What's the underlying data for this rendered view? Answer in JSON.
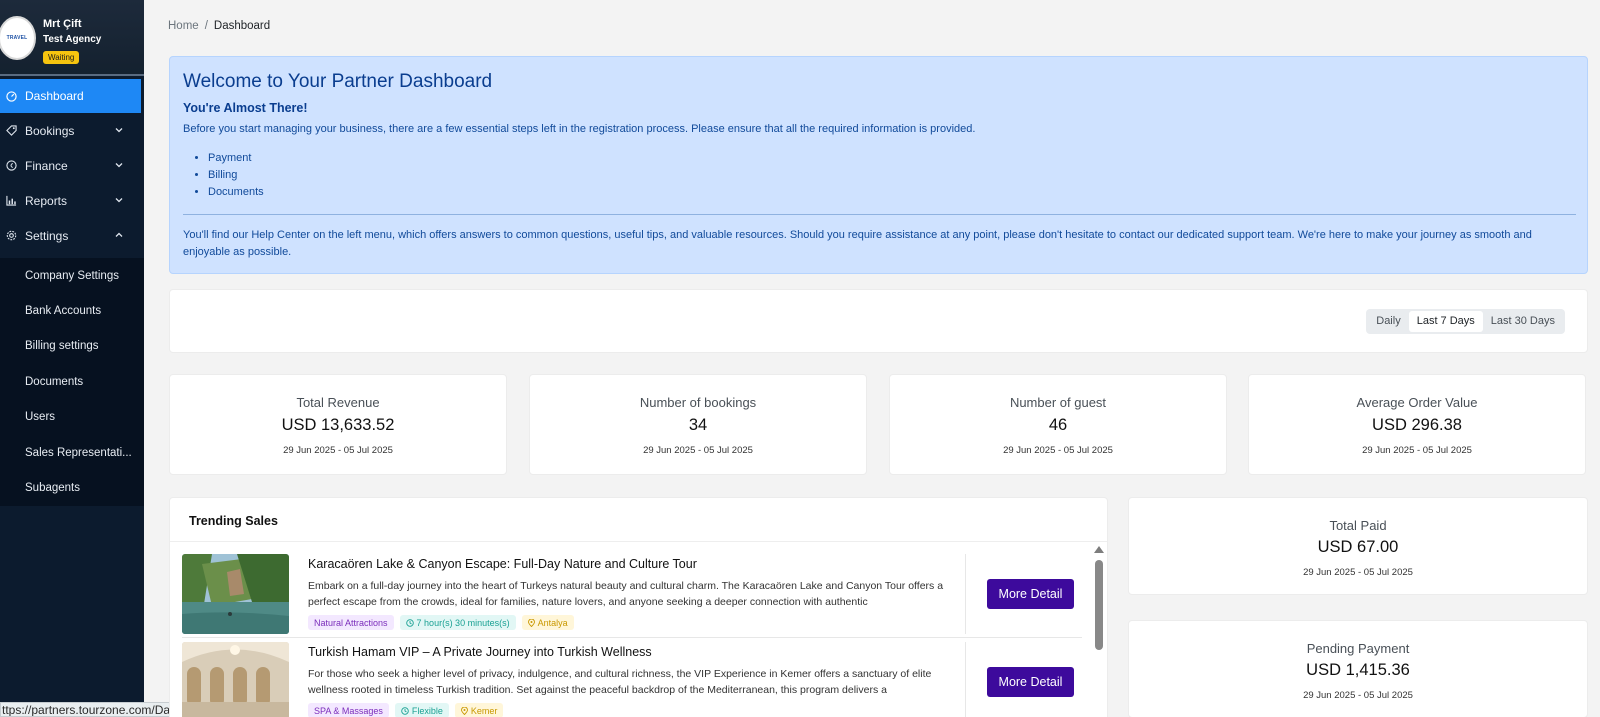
{
  "sidebar": {
    "logo_text": "TRAVEL",
    "user_name": "Mrt Çift",
    "agency_name": "Test Agency",
    "status": "Waiting",
    "nav": [
      {
        "label": "Dashboard",
        "icon": "gauge-icon",
        "active": true
      },
      {
        "label": "Bookings",
        "icon": "tag-icon",
        "chevron": "chevron-down-icon"
      },
      {
        "label": "Finance",
        "icon": "currency-icon",
        "chevron": "chevron-down-icon"
      },
      {
        "label": "Reports",
        "icon": "bar-chart-icon",
        "chevron": "chevron-down-icon"
      },
      {
        "label": "Settings",
        "icon": "gear-icon",
        "chevron": "chevron-up-icon"
      }
    ],
    "settings_submenu": [
      "Company Settings",
      "Bank Accounts",
      "Billing settings",
      "Documents",
      "Users",
      "Sales Representati...",
      "Subagents"
    ]
  },
  "status_bar": {
    "url": "ttps://partners.tourzone.com/Dashboard"
  },
  "breadcrumb": {
    "home": "Home",
    "separator": "/",
    "current": "Dashboard"
  },
  "welcome": {
    "title": "Welcome to Your Partner Dashboard",
    "subtitle": "You're Almost There!",
    "intro": "Before you start managing your business, there are a few essential steps left in the registration process. Please ensure that all the required information is provided.",
    "steps": [
      "Payment",
      "Billing",
      "Documents"
    ],
    "help": "You'll find our Help Center on the left menu, which offers answers to common questions, useful tips, and valuable resources. Should you require assistance at any point, please don't hesitate to contact our dedicated support team. We're here to make your journey as smooth and enjoyable as possible."
  },
  "period": {
    "options": [
      "Daily",
      "Last 7 Days",
      "Last 30 Days"
    ],
    "selected": "Last 7 Days"
  },
  "stats": [
    {
      "label": "Total Revenue",
      "value": "USD 13,633.52",
      "range": "29 Jun 2025 - 05 Jul 2025"
    },
    {
      "label": "Number of bookings",
      "value": "34",
      "range": "29 Jun 2025 - 05 Jul 2025"
    },
    {
      "label": "Number of guest",
      "value": "46",
      "range": "29 Jun 2025 - 05 Jul 2025"
    },
    {
      "label": "Average Order Value",
      "value": "USD 296.38",
      "range": "29 Jun 2025 - 05 Jul 2025"
    }
  ],
  "trending": {
    "title": "Trending Sales",
    "button_label": "More Detail",
    "tours": [
      {
        "title": "Karacaören Lake & Canyon Escape: Full-Day Nature and Culture Tour",
        "description": "Embark on a full-day journey into the heart of Turkeys natural beauty and cultural charm. The Karacaören Lake and Canyon Tour offers a perfect escape from the crowds, ideal for families, nature lovers, and anyone seeking a deeper connection with authentic",
        "category": "Natural Attractions",
        "duration": "7 hour(s) 30 minutes(s)",
        "location": "Antalya"
      },
      {
        "title": "Turkish Hamam VIP – A Private Journey into Turkish Wellness",
        "description": "For those who seek a higher level of privacy, indulgence, and cultural richness, the VIP Experience in Kemer offers a sanctuary of elite wellness rooted in timeless Turkish tradition. Set against the peaceful backdrop of the Mediterranean, this program delivers a",
        "category": "SPA & Massages",
        "duration": "Flexible",
        "location": "Kemer"
      }
    ]
  },
  "side_stats": [
    {
      "label": "Total Paid",
      "value": "USD 67.00",
      "range": "29 Jun 2025 - 05 Jul 2025"
    },
    {
      "label": "Pending Payment",
      "value": "USD 1,415.36",
      "range": "29 Jun 2025 - 05 Jul 2025"
    }
  ],
  "colors": {
    "sidebar_bg": "#0c1b2e",
    "active_nav": "#1e88f5",
    "welcome_bg": "#cfe2ff",
    "primary_button": "#3d0a9c",
    "status_badge": "#f6c40f"
  }
}
